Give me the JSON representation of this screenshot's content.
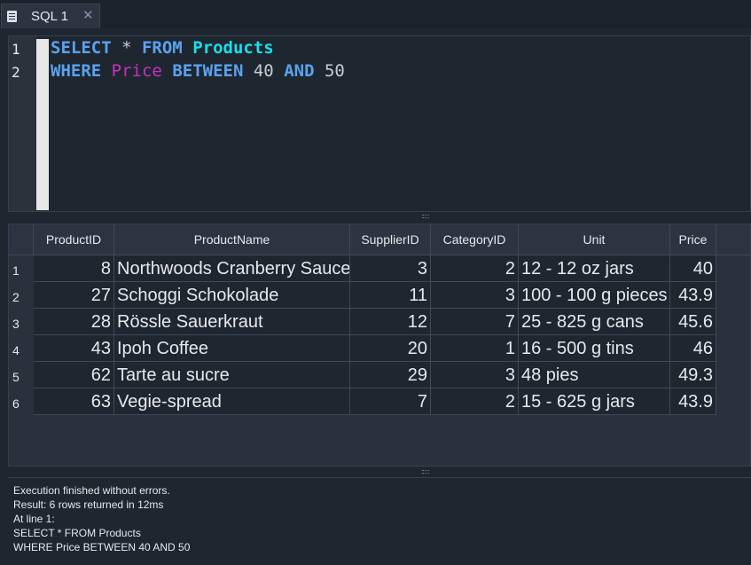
{
  "tab": {
    "label": "SQL 1",
    "close": "✕"
  },
  "editor": {
    "line_numbers": [
      "1",
      "2"
    ],
    "line1": {
      "kw1": "SELECT",
      "star": " * ",
      "kw2": "FROM",
      "table": "Products"
    },
    "line2": {
      "kw1": "WHERE",
      "column": "Price",
      "kw2": "BETWEEN",
      "low": "40",
      "kw3": "AND",
      "high": "50"
    }
  },
  "results": {
    "columns": [
      "ProductID",
      "ProductName",
      "SupplierID",
      "CategoryID",
      "Unit",
      "Price"
    ],
    "rows": [
      {
        "n": "1",
        "ProductID": "8",
        "ProductName": "Northwoods Cranberry Sauce",
        "SupplierID": "3",
        "CategoryID": "2",
        "Unit": "12 - 12 oz jars",
        "Price": "40"
      },
      {
        "n": "2",
        "ProductID": "27",
        "ProductName": "Schoggi Schokolade",
        "SupplierID": "11",
        "CategoryID": "3",
        "Unit": "100 - 100 g pieces",
        "Price": "43.9"
      },
      {
        "n": "3",
        "ProductID": "28",
        "ProductName": "Rössle Sauerkraut",
        "SupplierID": "12",
        "CategoryID": "7",
        "Unit": "25 - 825 g cans",
        "Price": "45.6"
      },
      {
        "n": "4",
        "ProductID": "43",
        "ProductName": "Ipoh Coffee",
        "SupplierID": "20",
        "CategoryID": "1",
        "Unit": "16 - 500 g tins",
        "Price": "46"
      },
      {
        "n": "5",
        "ProductID": "62",
        "ProductName": "Tarte au sucre",
        "SupplierID": "29",
        "CategoryID": "3",
        "Unit": "48 pies",
        "Price": "49.3"
      },
      {
        "n": "6",
        "ProductID": "63",
        "ProductName": "Vegie-spread",
        "SupplierID": "7",
        "CategoryID": "2",
        "Unit": "15 - 625 g jars",
        "Price": "43.9"
      }
    ]
  },
  "messages": {
    "lines": [
      "Execution finished without errors.",
      "Result: 6 rows returned in 12ms",
      "At line 1:",
      "SELECT * FROM Products",
      "WHERE Price BETWEEN 40 AND 50"
    ]
  },
  "colors": {
    "background": "#1e2630",
    "keyword": "#5aa2ef",
    "table": "#19dfea",
    "column": "#c931c2",
    "text": "#e6e9ee"
  }
}
